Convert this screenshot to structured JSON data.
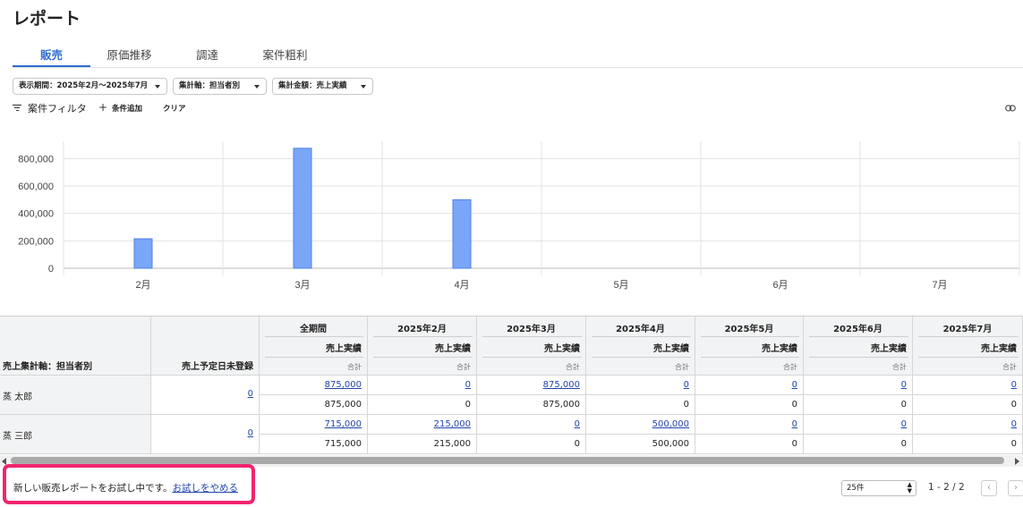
{
  "page": {
    "title": "レポート"
  },
  "tabs": [
    "販売",
    "原価推移",
    "調達",
    "案件粗利"
  ],
  "active_tab": "販売",
  "filters": {
    "period": "表示期間：2025年2月〜2025年7月",
    "axis": "集計軸：担当者別",
    "amount": "集計金額：売上実績"
  },
  "filterbar": {
    "filter_label": "案件フィルタ",
    "add_label": "条件追加",
    "clear_label": "クリア"
  },
  "chart_data": {
    "type": "bar",
    "categories": [
      "2月",
      "3月",
      "4月",
      "5月",
      "6月",
      "7月"
    ],
    "values": [
      215000,
      875000,
      500000,
      0,
      0,
      0
    ],
    "y_ticks": [
      "0",
      "200,000",
      "400,000",
      "600,000",
      "800,000"
    ],
    "ylim": [
      0,
      900000
    ],
    "bar_color": "#7aa6f8",
    "bar_edge_color": "#4f80e8",
    "grid": true
  },
  "table": {
    "row_header_label": "売上集計軸：担当者別",
    "unscheduled_label": "売上予定日未登録",
    "columns": [
      "全期間",
      "2025年2月",
      "2025年3月",
      "2025年4月",
      "2025年5月",
      "2025年6月",
      "2025年7月"
    ],
    "metric_label": "売上実績",
    "sum_label": "合計",
    "rows": [
      {
        "name": "蒸 太郎",
        "unscheduled": "0",
        "links": [
          "875,000",
          "0",
          "875,000",
          "0",
          "0",
          "0",
          "0"
        ],
        "totals": [
          "875,000",
          "0",
          "875,000",
          "0",
          "0",
          "0",
          "0"
        ]
      },
      {
        "name": "蒸 三郎",
        "unscheduled": "0",
        "links": [
          "715,000",
          "215,000",
          "0",
          "500,000",
          "0",
          "0",
          "0"
        ],
        "totals": [
          "715,000",
          "215,000",
          "0",
          "500,000",
          "0",
          "0",
          "0"
        ]
      }
    ]
  },
  "trial": {
    "message": "新しい販売レポートをお試し中です。",
    "link": "お試しをやめる"
  },
  "pagination": {
    "per_page": "25件",
    "range": "1 - 2 / 2"
  },
  "colors": {
    "accent": "#2f6fd1",
    "highlight_border": "#f0246e",
    "link": "#2244aa"
  }
}
